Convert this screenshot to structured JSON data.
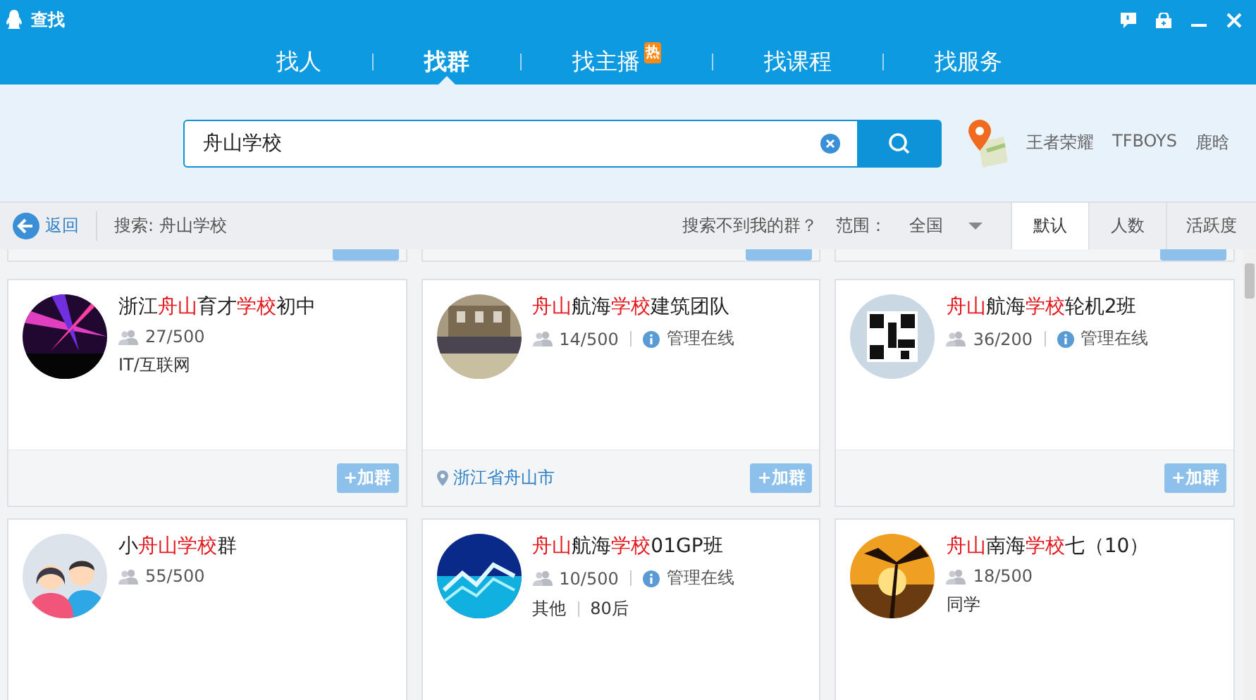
{
  "window": {
    "title": "查找"
  },
  "tabs": [
    {
      "label": "找人",
      "selected": false
    },
    {
      "label": "找群",
      "selected": true
    },
    {
      "label": "找主播",
      "selected": false,
      "badge": "热"
    },
    {
      "label": "找课程",
      "selected": false
    },
    {
      "label": "找服务",
      "selected": false
    }
  ],
  "search": {
    "value": "舟山学校",
    "hot_words": [
      "王者荣耀",
      "TFBOYS",
      "鹿晗"
    ]
  },
  "toolbar": {
    "back": "返回",
    "query": "搜索: 舟山学校",
    "not_found": "搜索不到我的群？",
    "range_label": "范围：",
    "range_value": "全国",
    "sort": [
      {
        "label": "默认",
        "selected": true
      },
      {
        "label": "人数",
        "selected": false
      },
      {
        "label": "活跃度",
        "selected": false
      }
    ]
  },
  "groups": [
    {
      "name": [
        {
          "text": "浙江",
          "highlight": false
        },
        {
          "text": "舟山",
          "highlight": true
        },
        {
          "text": "育才",
          "highlight": false
        },
        {
          "text": "学校",
          "highlight": true
        },
        {
          "text": "初中",
          "highlight": false
        }
      ],
      "avatar": {
        "kind": "picture"
      },
      "members": "27/500",
      "tags": [
        "IT/互联网"
      ],
      "join": "+加群"
    },
    {
      "name": [
        {
          "text": "舟山",
          "highlight": true
        },
        {
          "text": "航海",
          "highlight": false
        },
        {
          "text": "学校",
          "highlight": true
        },
        {
          "text": "建筑团队",
          "highlight": false
        }
      ],
      "avatar": {
        "kind": "picture"
      },
      "members": "14/500",
      "admin": "管理在线",
      "location": "浙江省舟山市",
      "join": "+加群"
    },
    {
      "name": [
        {
          "text": "舟山",
          "highlight": true
        },
        {
          "text": "航海",
          "highlight": false
        },
        {
          "text": "学校",
          "highlight": true
        },
        {
          "text": "轮机2班",
          "highlight": false
        }
      ],
      "avatar": {
        "kind": "picture"
      },
      "members": "36/200",
      "admin": "管理在线",
      "join": "+加群"
    },
    {
      "name": [
        {
          "text": "小",
          "highlight": false
        },
        {
          "text": "舟山",
          "highlight": true
        },
        {
          "text": "学校",
          "highlight": true
        },
        {
          "text": "群",
          "highlight": false
        }
      ],
      "avatar": {
        "kind": "default"
      },
      "members": "55/500"
    },
    {
      "name": [
        {
          "text": "舟山",
          "highlight": true
        },
        {
          "text": "航海",
          "highlight": false
        },
        {
          "text": "学校",
          "highlight": true
        },
        {
          "text": "01GP班",
          "highlight": false
        }
      ],
      "avatar": {
        "kind": "picture"
      },
      "members": "10/500",
      "admin": "管理在线",
      "tags": [
        "其他",
        "80后"
      ]
    },
    {
      "name": [
        {
          "text": "舟山",
          "highlight": true
        },
        {
          "text": "南海",
          "highlight": false
        },
        {
          "text": "学校",
          "highlight": true
        },
        {
          "text": "七（10）",
          "highlight": false
        }
      ],
      "avatar": {
        "kind": "picture"
      },
      "members": "18/500",
      "tags": [
        "同学"
      ]
    }
  ]
}
